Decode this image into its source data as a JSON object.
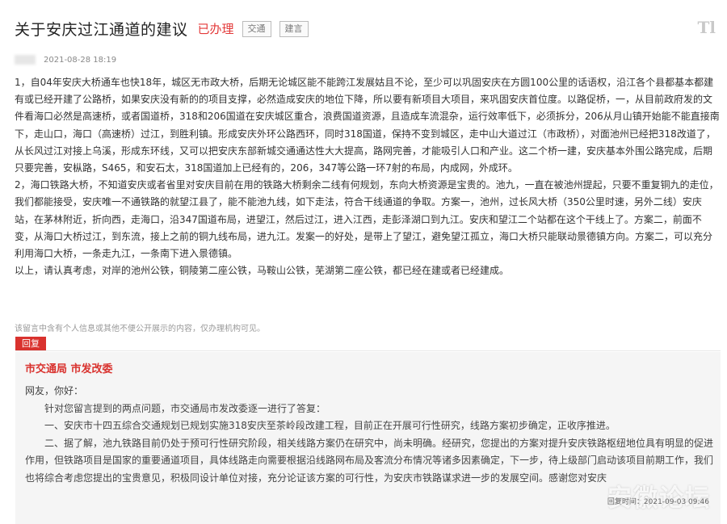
{
  "header": {
    "title": "关于安庆过江通道的建议",
    "status": "已办理",
    "tags": [
      "交通",
      "建言"
    ],
    "font_toggle": "Tl"
  },
  "meta": {
    "date": "2021-08-28 18:19"
  },
  "message": {
    "paragraphs": [
      "1，自04年安庆大桥通车也快18年，城区无市政大桥，后期无论城区能不能跨江发展姑且不论，至少可以巩固安庆在方圆100公里的话语权，沿江各个县都基本都建有或已经开建了公路桥，如果安庆没有新的的项目支撑，必然造成安庆的地位下降，所以要有新项目大项目，来巩固安庆首位度。以路促桥，一，从目前政府发的文件看海口必然是高速桥，或者国道桥，318和206国道在安庆城区重合，浪费国道资源，且造成车流混杂，运行效率低下，必须拆分，206从月山镇开始能不能直接南下，走山口，海口（高速桥）过江，到胜利镇。形成安庆外环公路西环，同时318国道，保持不变到城区，走中山大道过江（市政桥），对面池州已经把318改道了，从长风过江对接上乌溪，形成东环线，又可以把安庆东部新城交通通达性大大提高，路网完善，才能吸引人口和产业。这二个桥一建，安庆基本外围公路完成，后期只要完善，安枞路，S465，和安石太，318国道加上已经有的，206，347等公路一环7射的布局，内成网，外成环。",
      "2，海口铁路大桥，不知道安庆或者省里对安庆目前在用的铁路大桥剩余二线有何规划，东向大桥资源是宝贵的。池九，一直在被池州提起，只要不重复铜九的走位，我们都能接受，安庆唯一不通铁路的就望江县了，能不能池九线，如下走法，符合干线通道的争取。方案一，池州，过长风大桥（350公里时速，另外二线）安庆站，在茅林附近，折向西，走海口，沿347国道布局，进望江，然后过江，进入江西，走彭泽湖口到九江。安庆和望江二个站都在这个干线上了。方案二，前面不变，从海口大桥过江，到东流，接上之前的铜九线布局，进九江。发案一的好处，是带上了望江，避免望江孤立，海口大桥只能联动景德镇方向。方案二，可以充分利用海口大桥，一条走九江，一条南下进入景德镇。",
      "以上，请认真考虑，对岸的池州公铁，铜陵第二座公铁，马鞍山公铁，芜湖第二座公铁，都已经在建或者已经建成。"
    ]
  },
  "privacy_note": "该留言中含有个人信息或其他不便公开展示的内容，仅办理机构可见。",
  "reply": {
    "tab_label": "回复",
    "org": "市交通局 市发改委",
    "greeting": "网友，你好：",
    "paragraphs": [
      "针对您留言提到的两点问题，市交通局市发改委逐一进行了答复：",
      "一、安庆市十四五综合交通规划已规划实施318安庆至茶岭段改建工程，目前正在开展可行性研究，线路方案初步确定，正收序推进。",
      "二、据了解，池九铁路目前仍处于预可行性研究阶段，相关线路方案仍在研究中，尚未明确。经研究，您提出的方案对提升安庆铁路枢纽地位具有明显的促进作用，但铁路项目是国家的重要通道项目，具体线路走向需要根据沿线路网布局及客流分布情况等诸多因素确定，下一步，待上级部门启动该项目前期工作，我们也将综合考虑您提出的宝贵意见，积极同设计单位对接，充分论证该方案的可行性，为安庆市铁路谋求进一步的发展空间。感谢您对安庆"
    ],
    "time": "回复时间：2021-09-03 09:46",
    "watermark": "安徽论坛"
  }
}
